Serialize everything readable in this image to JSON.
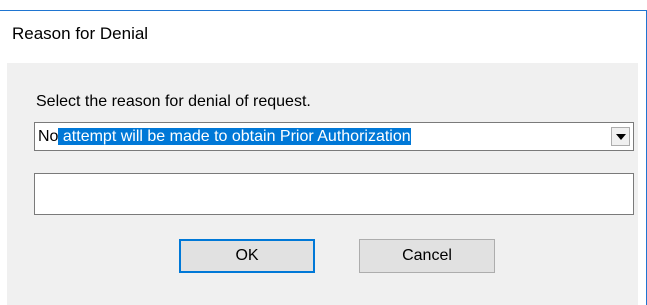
{
  "window": {
    "title": "Reason for Denial"
  },
  "form": {
    "prompt": "Select the reason for denial of request.",
    "reason_select": {
      "unselected_text": "No",
      "selected_text": " attempt will be made to obtain Prior Authorization",
      "dropdown_icon": "chevron-down-icon"
    },
    "comment_field": {
      "value": ""
    }
  },
  "buttons": {
    "ok_label": "OK",
    "cancel_label": "Cancel"
  },
  "colors": {
    "selection": "#0078d7",
    "window_border": "#1f75d1",
    "client_bg": "#f0f0f0"
  }
}
